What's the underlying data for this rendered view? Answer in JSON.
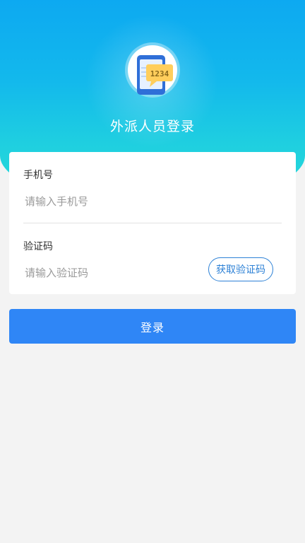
{
  "header": {
    "title": "外派人员登录",
    "logo_icon": "phone-verification-code-icon",
    "logo_code": "1234"
  },
  "form": {
    "phone": {
      "label": "手机号",
      "placeholder": "请输入手机号",
      "value": ""
    },
    "code": {
      "label": "验证码",
      "placeholder": "请输入验证码",
      "value": "",
      "button_label": "获取验证码"
    }
  },
  "login_button_label": "登录",
  "colors": {
    "gradient_top": "#0da9f1",
    "gradient_bottom": "#27dcd6",
    "accent": "#2f86f6",
    "code_button": "#2d81d6",
    "background": "#f3f3f3"
  }
}
